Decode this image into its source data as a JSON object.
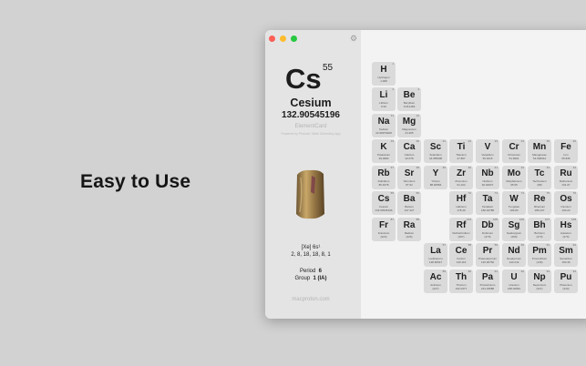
{
  "headline": "Easy to Use",
  "sidebar": {
    "symbol": "Cs",
    "atomic_number": "55",
    "name": "Cesium",
    "mass": "132.90545196",
    "brand": "ElementCard",
    "brand_sub": "Powered by\nPeriodic Table Chemistry App",
    "electron_config": "[Xe] 6s¹",
    "shells": "2, 8, 18, 18, 8, 1",
    "period_label": "Period",
    "period_value": "6",
    "group_label": "Group",
    "group_value": "1 (IA)",
    "footer": "macproton.com"
  },
  "elements": [
    {
      "n": "1",
      "s": "H",
      "name": "Hydrogen",
      "mass": "1.008",
      "r": 1,
      "c": 1
    },
    {
      "n": "3",
      "s": "Li",
      "name": "Lithium",
      "mass": "6.94",
      "r": 2,
      "c": 1
    },
    {
      "n": "4",
      "s": "Be",
      "name": "Beryllium",
      "mass": "9.012183",
      "r": 2,
      "c": 2
    },
    {
      "n": "11",
      "s": "Na",
      "name": "Sodium",
      "mass": "22.98976928",
      "r": 3,
      "c": 1
    },
    {
      "n": "12",
      "s": "Mg",
      "name": "Magnesium",
      "mass": "24.305",
      "r": 3,
      "c": 2
    },
    {
      "n": "19",
      "s": "K",
      "name": "Potassium",
      "mass": "39.0983",
      "r": 4,
      "c": 1
    },
    {
      "n": "20",
      "s": "Ca",
      "name": "Calcium",
      "mass": "40.078",
      "r": 4,
      "c": 2
    },
    {
      "n": "21",
      "s": "Sc",
      "name": "Scandium",
      "mass": "44.955908",
      "r": 4,
      "c": 3
    },
    {
      "n": "22",
      "s": "Ti",
      "name": "Titanium",
      "mass": "47.867",
      "r": 4,
      "c": 4
    },
    {
      "n": "23",
      "s": "V",
      "name": "Vanadium",
      "mass": "50.9415",
      "r": 4,
      "c": 5
    },
    {
      "n": "24",
      "s": "Cr",
      "name": "Chromium",
      "mass": "51.9961",
      "r": 4,
      "c": 6
    },
    {
      "n": "25",
      "s": "Mn",
      "name": "Manganese",
      "mass": "54.938044",
      "r": 4,
      "c": 7
    },
    {
      "n": "26",
      "s": "Fe",
      "name": "Iron",
      "mass": "55.845",
      "r": 4,
      "c": 8
    },
    {
      "n": "37",
      "s": "Rb",
      "name": "Rubidium",
      "mass": "85.4678",
      "r": 5,
      "c": 1
    },
    {
      "n": "38",
      "s": "Sr",
      "name": "Strontium",
      "mass": "87.62",
      "r": 5,
      "c": 2
    },
    {
      "n": "39",
      "s": "Y",
      "name": "Yttrium",
      "mass": "88.90584",
      "r": 5,
      "c": 3
    },
    {
      "n": "40",
      "s": "Zr",
      "name": "Zirconium",
      "mass": "91.224",
      "r": 5,
      "c": 4
    },
    {
      "n": "41",
      "s": "Nb",
      "name": "Niobium",
      "mass": "92.90637",
      "r": 5,
      "c": 5
    },
    {
      "n": "42",
      "s": "Mo",
      "name": "Molybdenum",
      "mass": "95.95",
      "r": 5,
      "c": 6
    },
    {
      "n": "43",
      "s": "Tc",
      "name": "Technetium",
      "mass": "(98)",
      "r": 5,
      "c": 7
    },
    {
      "n": "44",
      "s": "Ru",
      "name": "Ruthenium",
      "mass": "101.07",
      "r": 5,
      "c": 8
    },
    {
      "n": "55",
      "s": "Cs",
      "name": "Cesium",
      "mass": "132.90545196",
      "r": 6,
      "c": 1
    },
    {
      "n": "56",
      "s": "Ba",
      "name": "Barium",
      "mass": "137.327",
      "r": 6,
      "c": 2
    },
    {
      "n": "72",
      "s": "Hf",
      "name": "Hafnium",
      "mass": "178.49",
      "r": 6,
      "c": 4
    },
    {
      "n": "73",
      "s": "Ta",
      "name": "Tantalum",
      "mass": "180.94788",
      "r": 6,
      "c": 5
    },
    {
      "n": "74",
      "s": "W",
      "name": "Tungsten",
      "mass": "183.84",
      "r": 6,
      "c": 6
    },
    {
      "n": "75",
      "s": "Re",
      "name": "Rhenium",
      "mass": "186.207",
      "r": 6,
      "c": 7
    },
    {
      "n": "76",
      "s": "Os",
      "name": "Osmium",
      "mass": "190.23",
      "r": 6,
      "c": 8
    },
    {
      "n": "87",
      "s": "Fr",
      "name": "Francium",
      "mass": "(223)",
      "r": 7,
      "c": 1
    },
    {
      "n": "88",
      "s": "Ra",
      "name": "Radium",
      "mass": "(226)",
      "r": 7,
      "c": 2
    },
    {
      "n": "104",
      "s": "Rf",
      "name": "Rutherfordium",
      "mass": "(267)",
      "r": 7,
      "c": 4
    },
    {
      "n": "105",
      "s": "Db",
      "name": "Dubnium",
      "mass": "(270)",
      "r": 7,
      "c": 5
    },
    {
      "n": "106",
      "s": "Sg",
      "name": "Seaborgium",
      "mass": "(269)",
      "r": 7,
      "c": 6
    },
    {
      "n": "107",
      "s": "Bh",
      "name": "Bohrium",
      "mass": "(270)",
      "r": 7,
      "c": 7
    },
    {
      "n": "108",
      "s": "Hs",
      "name": "Hassium",
      "mass": "(270)",
      "r": 7,
      "c": 8
    },
    {
      "n": "57",
      "s": "La",
      "name": "Lanthanum",
      "mass": "138.90547",
      "r": 8,
      "c": 3
    },
    {
      "n": "58",
      "s": "Ce",
      "name": "Cerium",
      "mass": "140.116",
      "r": 8,
      "c": 4
    },
    {
      "n": "59",
      "s": "Pr",
      "name": "Praseodymium",
      "mass": "140.90766",
      "r": 8,
      "c": 5
    },
    {
      "n": "60",
      "s": "Nd",
      "name": "Neodymium",
      "mass": "144.242",
      "r": 8,
      "c": 6
    },
    {
      "n": "61",
      "s": "Pm",
      "name": "Promethium",
      "mass": "(145)",
      "r": 8,
      "c": 7
    },
    {
      "n": "62",
      "s": "Sm",
      "name": "Samarium",
      "mass": "150.36",
      "r": 8,
      "c": 8
    },
    {
      "n": "89",
      "s": "Ac",
      "name": "Actinium",
      "mass": "(227)",
      "r": 9,
      "c": 3
    },
    {
      "n": "90",
      "s": "Th",
      "name": "Thorium",
      "mass": "232.0377",
      "r": 9,
      "c": 4
    },
    {
      "n": "91",
      "s": "Pa",
      "name": "Protactinium",
      "mass": "231.03588",
      "r": 9,
      "c": 5
    },
    {
      "n": "92",
      "s": "U",
      "name": "Uranium",
      "mass": "238.02891",
      "r": 9,
      "c": 6
    },
    {
      "n": "93",
      "s": "Np",
      "name": "Neptunium",
      "mass": "(237)",
      "r": 9,
      "c": 7
    },
    {
      "n": "94",
      "s": "Pu",
      "name": "Plutonium",
      "mass": "(244)",
      "r": 9,
      "c": 8
    }
  ]
}
